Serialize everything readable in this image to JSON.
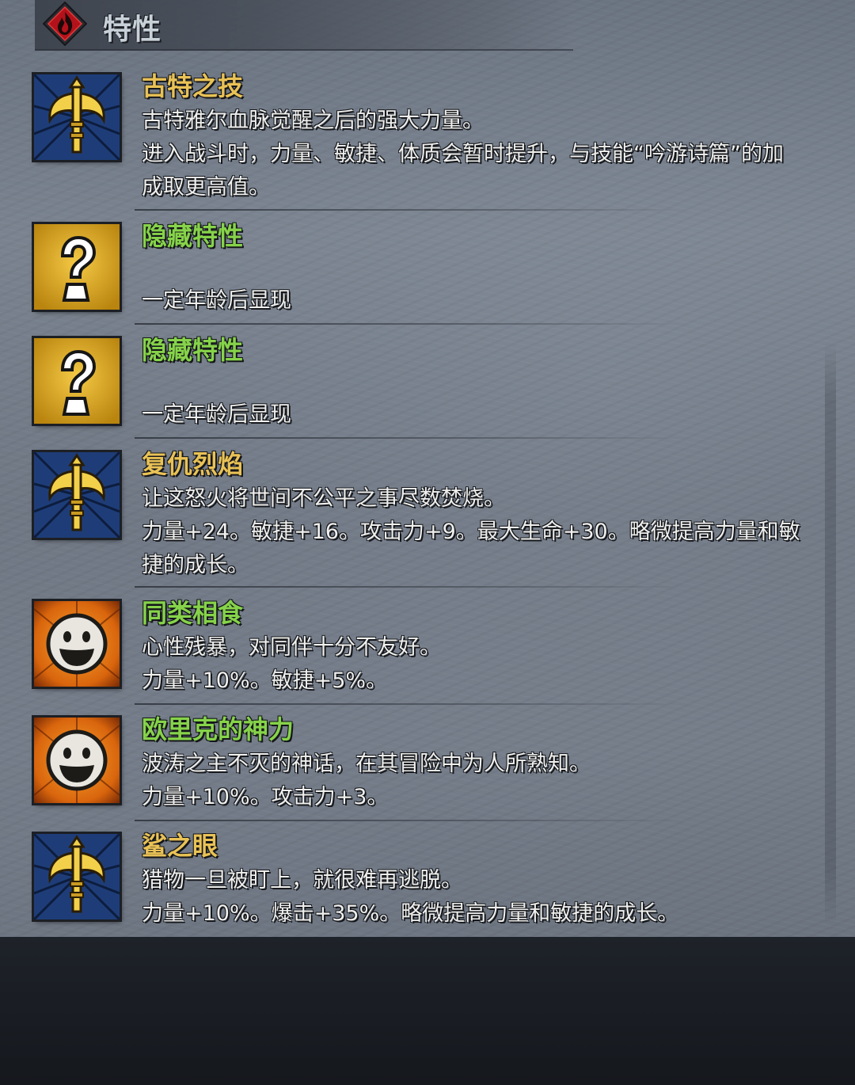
{
  "header": {
    "icon": "flame-emblem-icon",
    "title": "特性"
  },
  "colors": {
    "trait_name_gold": "#e9c256",
    "trait_name_green": "#86d34a",
    "description_text": "#f0f0ee",
    "panel_bg": "#737b87"
  },
  "traits": [
    {
      "icon": "axe-emblem-icon",
      "name": "古特之技",
      "name_color": "gold",
      "description": "古特雅尔血脉觉醒之后的强大力量。",
      "effect": "进入战斗时，力量、敏捷、体质会暂时提升，与技能“吟游诗篇”的加",
      "effect_cont": "成取更高值。"
    },
    {
      "icon": "question-mark-icon",
      "name": "隐藏特性",
      "name_color": "green",
      "effect": "一定年龄后显现"
    },
    {
      "icon": "question-mark-icon",
      "name": "隐藏特性",
      "name_color": "green",
      "effect": "一定年龄后显现"
    },
    {
      "icon": "axe-emblem-icon",
      "name": "复仇烈焰",
      "name_color": "gold",
      "description": "让这怒火将世间不公平之事尽数焚烧。",
      "effect": "力量+24。敏捷+16。攻击力+9。最大生命+30。略微提高力量和敏",
      "effect_cont": "捷的成长。"
    },
    {
      "icon": "grinning-face-icon",
      "name": "同类相食",
      "name_color": "green",
      "description": "心性残暴，对同伴十分不友好。",
      "effect": "力量+10%。敏捷+5%。"
    },
    {
      "icon": "grinning-face-icon",
      "name": "欧里克的神力",
      "name_color": "green",
      "description": "波涛之主不灭的神话，在其冒险中为人所熟知。",
      "effect": "力量+10%。攻击力+3。"
    },
    {
      "icon": "axe-emblem-icon",
      "name": "鲨之眼",
      "name_color": "gold",
      "description": "猎物一旦被盯上，就很难再逃脱。",
      "effect": "力量+10%。爆击+35%。略微提高力量和敏捷的成长。"
    }
  ]
}
